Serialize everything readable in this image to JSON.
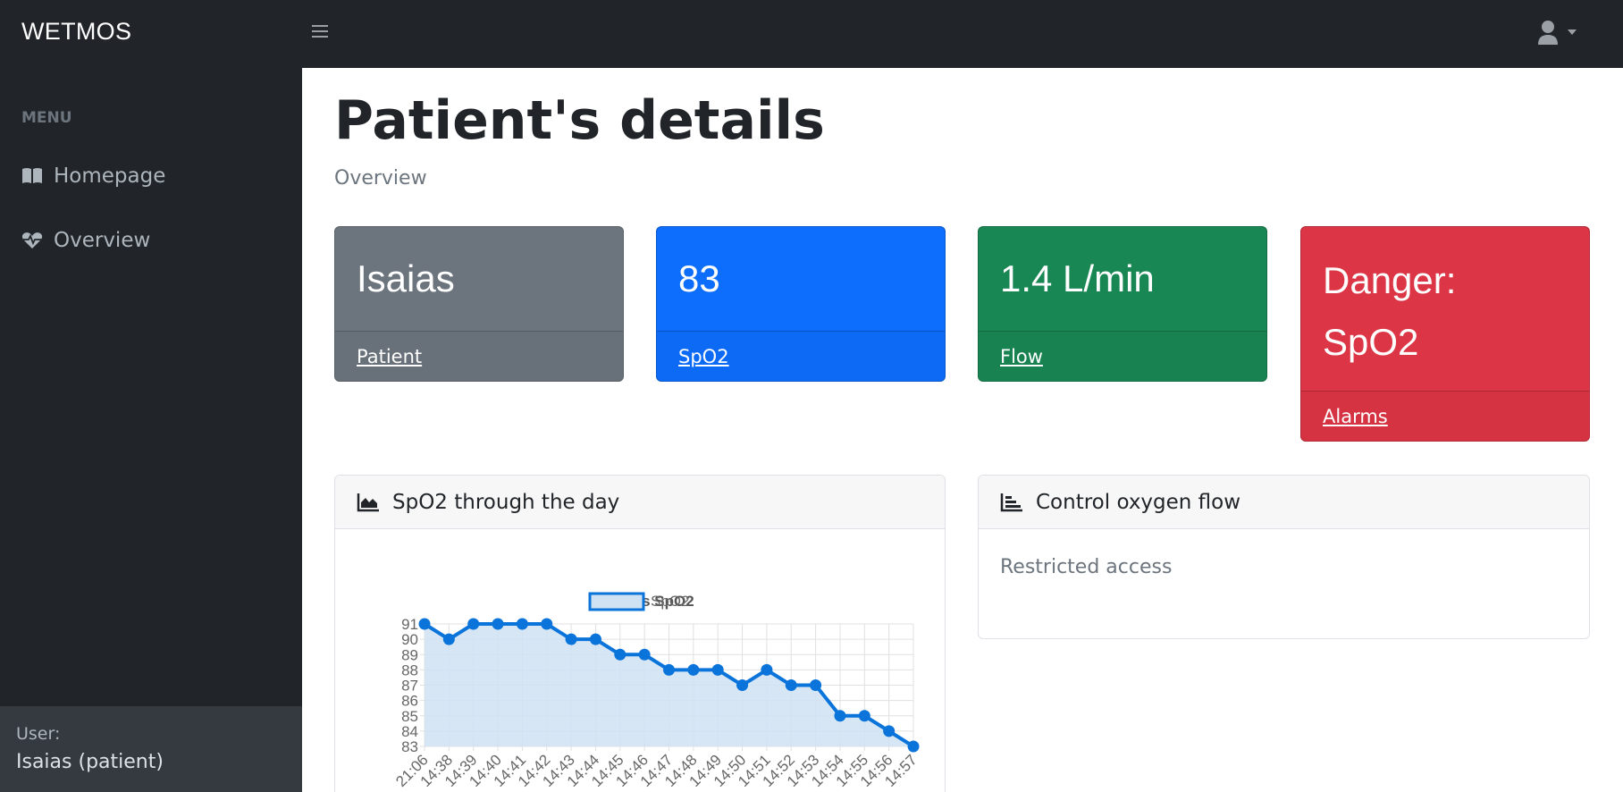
{
  "app": {
    "brand": "WETMOS"
  },
  "sidebar": {
    "heading": "MENU",
    "items": [
      {
        "label": "Homepage",
        "icon": "book-icon"
      },
      {
        "label": "Overview",
        "icon": "heartbeat-icon"
      }
    ],
    "footer": {
      "label": "User:",
      "user": "Isaias (patient)"
    }
  },
  "header": {
    "user_icon": "user-icon"
  },
  "main": {
    "title": "Patient's details",
    "subtitle": "Overview",
    "cards": [
      {
        "value": "Isaias",
        "link": "Patient",
        "color": "#6c757d"
      },
      {
        "value": "83",
        "link": "SpO2",
        "color": "#0d6efd"
      },
      {
        "value": "1.4 L/min",
        "link": "Flow",
        "color": "#198754"
      },
      {
        "value": "Danger:",
        "value_line2": "SpO2",
        "link": "Alarms",
        "color": "#dc3545"
      }
    ],
    "chart_panel": {
      "title": "SpO2 through the day",
      "icon": "area-chart-icon"
    },
    "control_panel": {
      "title": "Control oxygen flow",
      "icon": "bar-chart-icon",
      "message": "Restricted access"
    }
  },
  "chart_data": {
    "type": "line",
    "title": "Patient's SpO2",
    "legend_position": "top",
    "grid": true,
    "ylim": [
      83,
      91
    ],
    "x": [
      "21:06",
      "14:38",
      "14:39",
      "14:40",
      "14:41",
      "14:42",
      "14:43",
      "14:44",
      "14:45",
      "14:46",
      "14:47",
      "14:48",
      "14:49",
      "14:50",
      "14:51",
      "14:52",
      "14:53",
      "14:54",
      "14:55",
      "14:56",
      "14:57"
    ],
    "series": [
      {
        "name": "SpO2",
        "color": "#0a74da",
        "fill": "#cfe2f3",
        "values": [
          91,
          90,
          91,
          91,
          91,
          91,
          90,
          90,
          89,
          89,
          88,
          88,
          88,
          87,
          88,
          87,
          87,
          85,
          85,
          84,
          83
        ]
      }
    ]
  }
}
